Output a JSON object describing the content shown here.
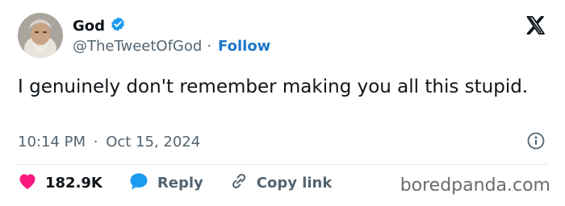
{
  "author": {
    "name": "God",
    "handle": "@TheTweetOfGod",
    "separator": "·",
    "follow_label": "Follow",
    "verified_icon": "verified-badge-icon"
  },
  "tweet": {
    "text": "I genuinely don't remember making you all this stupid.",
    "time": "10:14 PM",
    "date_separator": "·",
    "date": "Oct 15, 2024"
  },
  "actions": {
    "like_count": "182.9K",
    "reply_label": "Reply",
    "copy_link_label": "Copy link"
  },
  "watermark": "boredpanda.com",
  "colors": {
    "accent": "#1d9bf0",
    "follow": "#1d77c9",
    "like": "#f91880",
    "text": "#0f1419",
    "muted": "#536471"
  }
}
